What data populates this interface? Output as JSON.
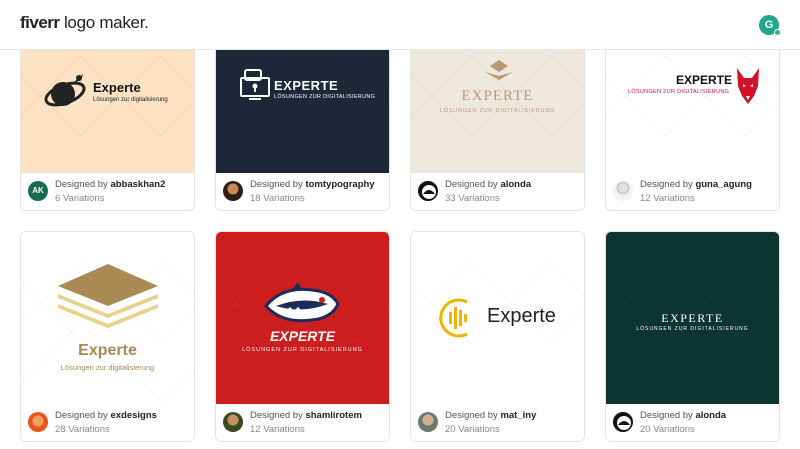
{
  "header": {
    "brand_part1": "fiverr",
    "brand_part2": " logo maker.",
    "user_initial": "G"
  },
  "cards": [
    {
      "logo_title": "Experte",
      "logo_subtitle": "Lösungen zur digitalisierung",
      "designed_by_prefix": "Designed by ",
      "designer": "abbaskhan2",
      "variations": "6 Variations",
      "avatar_text": "AK",
      "bg": "#fde2c3"
    },
    {
      "logo_title": "EXPERTE",
      "logo_subtitle": "LÖSUNGEN ZUR DIGITALISIERUNG",
      "designed_by_prefix": "Designed by ",
      "designer": "tomtypography",
      "variations": "18 Variations",
      "bg": "#1d2738"
    },
    {
      "logo_title": "EXPERTE",
      "logo_subtitle": "LÖSUNGEN ZUR DIGITALISIERUNG",
      "designed_by_prefix": "Designed by ",
      "designer": "alonda",
      "variations": "33 Variations",
      "bg": "#efe9dd"
    },
    {
      "logo_title": "EXPERTE",
      "logo_subtitle": "LÖSUNGEN ZUR DIGITALISIERUNG",
      "designed_by_prefix": "Designed by ",
      "designer": "guna_agung",
      "variations": "12 Variations",
      "bg": "#ffffff"
    },
    {
      "logo_title": "Experte",
      "logo_subtitle": "Lösungen zur digitalisierung",
      "designed_by_prefix": "Designed by ",
      "designer": "exdesigns",
      "variations": "28 Variations",
      "bg": "#ffffff"
    },
    {
      "logo_title": "EXPERTE",
      "logo_subtitle": "LÖSUNGEN ZUR DIGITALISIERUNG",
      "designed_by_prefix": "Designed by ",
      "designer": "shamlirotem",
      "variations": "12 Variations",
      "bg": "#cc1d1f"
    },
    {
      "logo_title": "Experte",
      "designed_by_prefix": "Designed by ",
      "designer": "mat_iny",
      "variations": "20 Variations",
      "bg": "#ffffff"
    },
    {
      "logo_title": "EXPERTE",
      "logo_subtitle": "LÖSUNGEN ZUR DIGITALISIERUNG",
      "designed_by_prefix": "Designed by ",
      "designer": "alonda",
      "variations": "20 Variations",
      "bg": "#0c3530"
    }
  ],
  "colors": {
    "accent_green": "#1dbf73",
    "user_avatar": "#1ea68f"
  }
}
